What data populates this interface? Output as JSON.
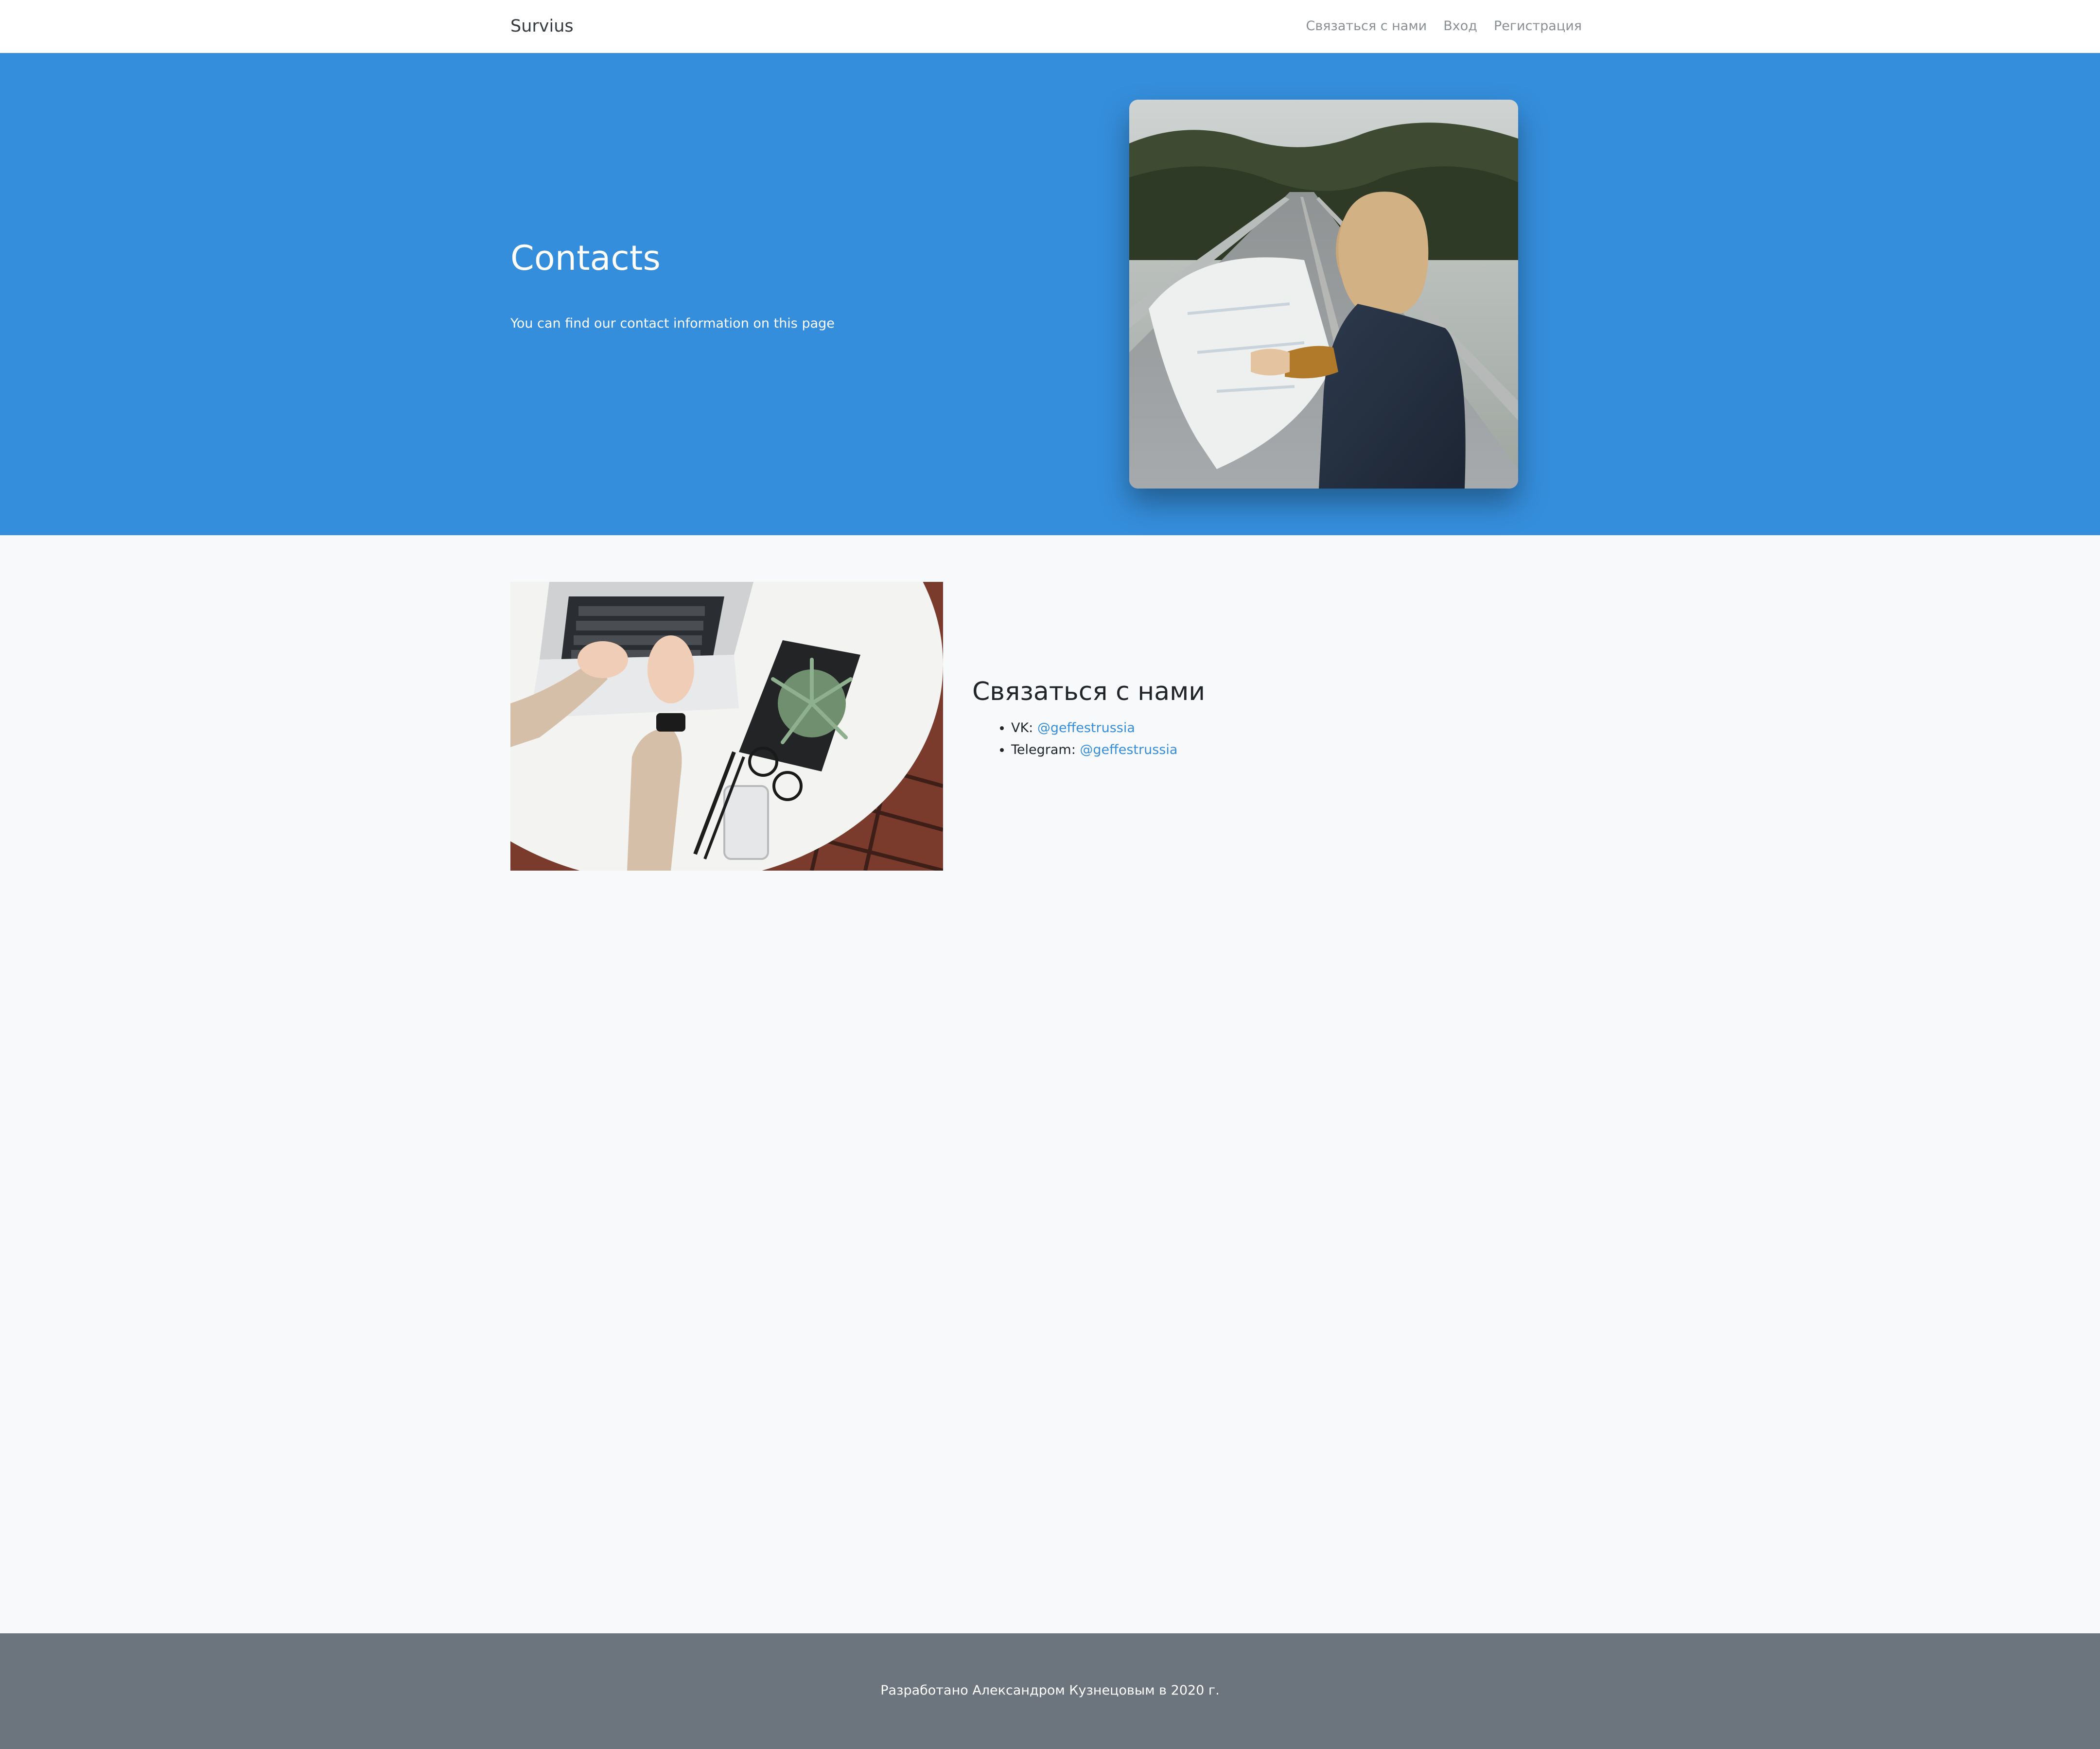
{
  "navbar": {
    "brand": "Survius",
    "links": [
      {
        "label": "Связаться с нами"
      },
      {
        "label": "Вход"
      },
      {
        "label": "Регистрация"
      }
    ]
  },
  "hero": {
    "title": "Contacts",
    "subtitle": "You can find our contact information on this page",
    "background_color": "#358edc"
  },
  "contact": {
    "title": "Связаться с нами",
    "items": [
      {
        "label": "VK: ",
        "handle": "@geffestrussia"
      },
      {
        "label": "Telegram: ",
        "handle": "@geffestrussia"
      }
    ],
    "link_color": "#358edc"
  },
  "footer": {
    "text": "Разработано Александром Кузнецовым в 2020 г.",
    "background_color": "#6c757d"
  }
}
